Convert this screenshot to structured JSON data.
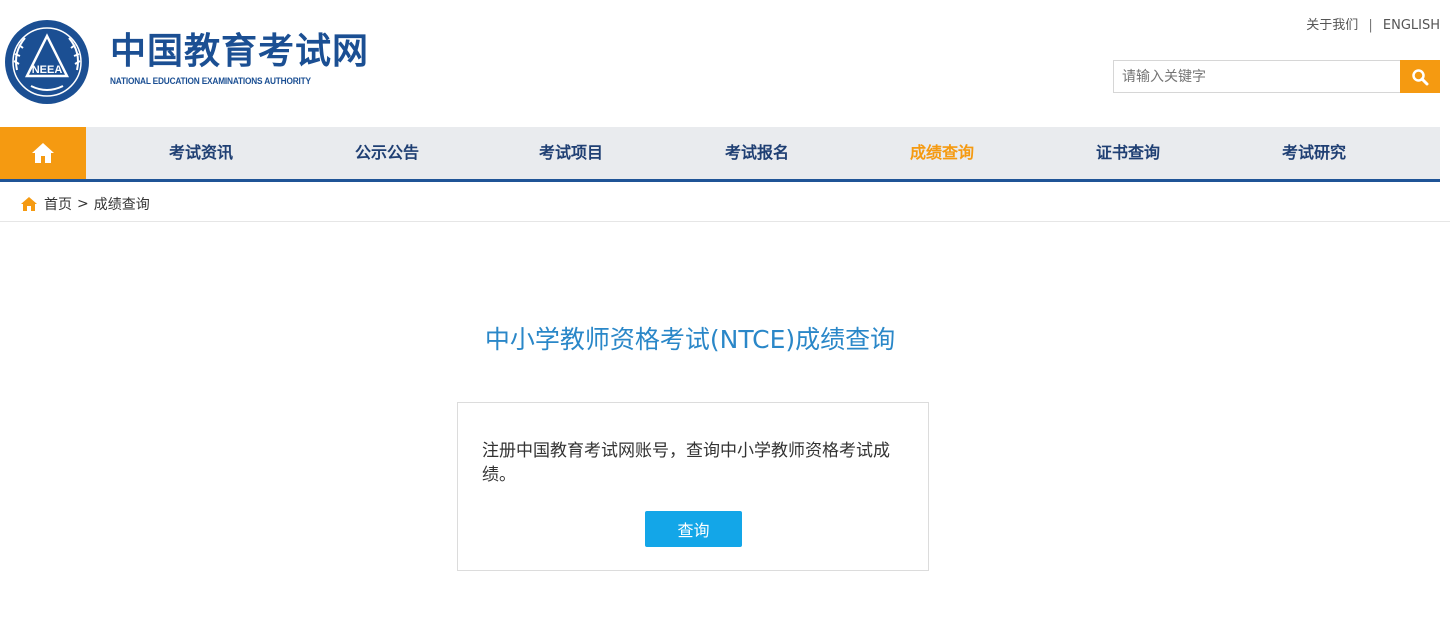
{
  "header": {
    "site_name_cn": "中国教育考试网",
    "site_name_en": "NATIONAL EDUCATION EXAMINATIONS AUTHORITY",
    "emblem_text": "NEEA",
    "top_links": {
      "about": "关于我们",
      "separator": "|",
      "english": "ENGLISH"
    },
    "search": {
      "placeholder": "请输入关键字",
      "button_icon": "search-icon"
    }
  },
  "nav": {
    "home_icon": "home-icon",
    "items": [
      {
        "label": "考试资讯"
      },
      {
        "label": "公示公告"
      },
      {
        "label": "考试项目"
      },
      {
        "label": "考试报名"
      },
      {
        "label": "成绩查询",
        "active": true
      },
      {
        "label": "证书查询"
      },
      {
        "label": "考试研究"
      }
    ]
  },
  "breadcrumb": {
    "home": "首页",
    "separator": ">",
    "current": "成绩查询"
  },
  "main": {
    "title": "中小学教师资格考试(NTCE)成绩查询",
    "card_text": "注册中国教育考试网账号，查询中小学教师资格考试成绩。",
    "query_button": "查询"
  },
  "colors": {
    "brand_blue": "#1b4f93",
    "accent_orange": "#f59a11",
    "title_blue": "#2a87c8",
    "button_blue": "#13a6e8"
  }
}
